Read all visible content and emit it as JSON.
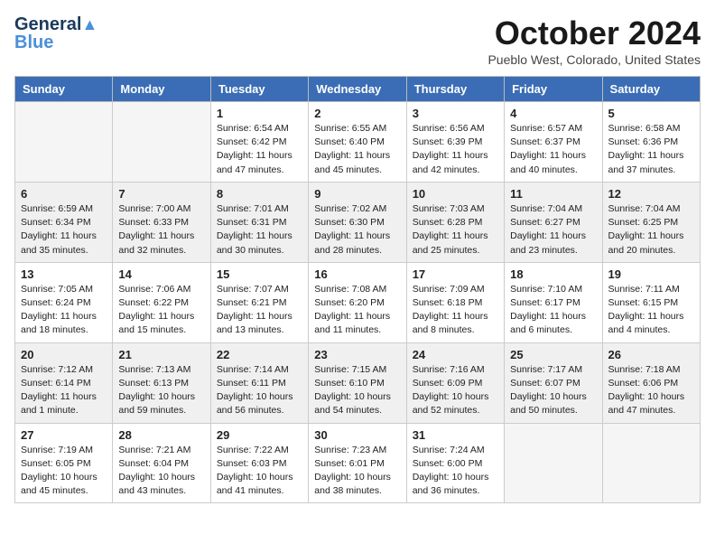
{
  "logo": {
    "line1": "General",
    "line2": "Blue"
  },
  "title": "October 2024",
  "subtitle": "Pueblo West, Colorado, United States",
  "days_of_week": [
    "Sunday",
    "Monday",
    "Tuesday",
    "Wednesday",
    "Thursday",
    "Friday",
    "Saturday"
  ],
  "weeks": [
    [
      {
        "day": "",
        "empty": true
      },
      {
        "day": "",
        "empty": true
      },
      {
        "day": "1",
        "info": "Sunrise: 6:54 AM\nSunset: 6:42 PM\nDaylight: 11 hours and 47 minutes."
      },
      {
        "day": "2",
        "info": "Sunrise: 6:55 AM\nSunset: 6:40 PM\nDaylight: 11 hours and 45 minutes."
      },
      {
        "day": "3",
        "info": "Sunrise: 6:56 AM\nSunset: 6:39 PM\nDaylight: 11 hours and 42 minutes."
      },
      {
        "day": "4",
        "info": "Sunrise: 6:57 AM\nSunset: 6:37 PM\nDaylight: 11 hours and 40 minutes."
      },
      {
        "day": "5",
        "info": "Sunrise: 6:58 AM\nSunset: 6:36 PM\nDaylight: 11 hours and 37 minutes."
      }
    ],
    [
      {
        "day": "6",
        "info": "Sunrise: 6:59 AM\nSunset: 6:34 PM\nDaylight: 11 hours and 35 minutes."
      },
      {
        "day": "7",
        "info": "Sunrise: 7:00 AM\nSunset: 6:33 PM\nDaylight: 11 hours and 32 minutes."
      },
      {
        "day": "8",
        "info": "Sunrise: 7:01 AM\nSunset: 6:31 PM\nDaylight: 11 hours and 30 minutes."
      },
      {
        "day": "9",
        "info": "Sunrise: 7:02 AM\nSunset: 6:30 PM\nDaylight: 11 hours and 28 minutes."
      },
      {
        "day": "10",
        "info": "Sunrise: 7:03 AM\nSunset: 6:28 PM\nDaylight: 11 hours and 25 minutes."
      },
      {
        "day": "11",
        "info": "Sunrise: 7:04 AM\nSunset: 6:27 PM\nDaylight: 11 hours and 23 minutes."
      },
      {
        "day": "12",
        "info": "Sunrise: 7:04 AM\nSunset: 6:25 PM\nDaylight: 11 hours and 20 minutes."
      }
    ],
    [
      {
        "day": "13",
        "info": "Sunrise: 7:05 AM\nSunset: 6:24 PM\nDaylight: 11 hours and 18 minutes."
      },
      {
        "day": "14",
        "info": "Sunrise: 7:06 AM\nSunset: 6:22 PM\nDaylight: 11 hours and 15 minutes."
      },
      {
        "day": "15",
        "info": "Sunrise: 7:07 AM\nSunset: 6:21 PM\nDaylight: 11 hours and 13 minutes."
      },
      {
        "day": "16",
        "info": "Sunrise: 7:08 AM\nSunset: 6:20 PM\nDaylight: 11 hours and 11 minutes."
      },
      {
        "day": "17",
        "info": "Sunrise: 7:09 AM\nSunset: 6:18 PM\nDaylight: 11 hours and 8 minutes."
      },
      {
        "day": "18",
        "info": "Sunrise: 7:10 AM\nSunset: 6:17 PM\nDaylight: 11 hours and 6 minutes."
      },
      {
        "day": "19",
        "info": "Sunrise: 7:11 AM\nSunset: 6:15 PM\nDaylight: 11 hours and 4 minutes."
      }
    ],
    [
      {
        "day": "20",
        "info": "Sunrise: 7:12 AM\nSunset: 6:14 PM\nDaylight: 11 hours and 1 minute."
      },
      {
        "day": "21",
        "info": "Sunrise: 7:13 AM\nSunset: 6:13 PM\nDaylight: 10 hours and 59 minutes."
      },
      {
        "day": "22",
        "info": "Sunrise: 7:14 AM\nSunset: 6:11 PM\nDaylight: 10 hours and 56 minutes."
      },
      {
        "day": "23",
        "info": "Sunrise: 7:15 AM\nSunset: 6:10 PM\nDaylight: 10 hours and 54 minutes."
      },
      {
        "day": "24",
        "info": "Sunrise: 7:16 AM\nSunset: 6:09 PM\nDaylight: 10 hours and 52 minutes."
      },
      {
        "day": "25",
        "info": "Sunrise: 7:17 AM\nSunset: 6:07 PM\nDaylight: 10 hours and 50 minutes."
      },
      {
        "day": "26",
        "info": "Sunrise: 7:18 AM\nSunset: 6:06 PM\nDaylight: 10 hours and 47 minutes."
      }
    ],
    [
      {
        "day": "27",
        "info": "Sunrise: 7:19 AM\nSunset: 6:05 PM\nDaylight: 10 hours and 45 minutes."
      },
      {
        "day": "28",
        "info": "Sunrise: 7:21 AM\nSunset: 6:04 PM\nDaylight: 10 hours and 43 minutes."
      },
      {
        "day": "29",
        "info": "Sunrise: 7:22 AM\nSunset: 6:03 PM\nDaylight: 10 hours and 41 minutes."
      },
      {
        "day": "30",
        "info": "Sunrise: 7:23 AM\nSunset: 6:01 PM\nDaylight: 10 hours and 38 minutes."
      },
      {
        "day": "31",
        "info": "Sunrise: 7:24 AM\nSunset: 6:00 PM\nDaylight: 10 hours and 36 minutes."
      },
      {
        "day": "",
        "empty": true
      },
      {
        "day": "",
        "empty": true
      }
    ]
  ]
}
